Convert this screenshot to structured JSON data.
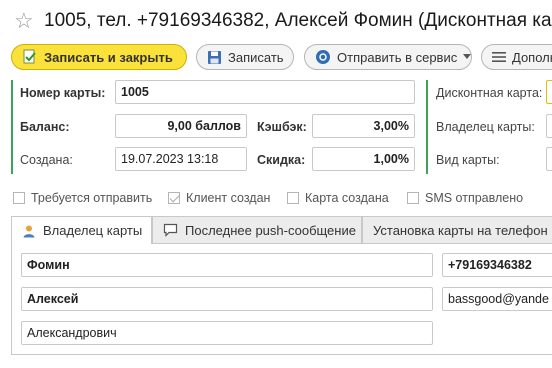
{
  "window": {
    "title": "1005, тел. +79169346382, Алексей Фомин (Дисконтная кар",
    "favorite_icon": "star-icon"
  },
  "toolbar": {
    "save_close_label": "Записать и закрыть",
    "save_label": "Записать",
    "send_label": "Отправить в сервис",
    "more_label": "Дополн"
  },
  "card": {
    "number_label": "Номер карты:",
    "number_value": "1005",
    "balance_label": "Баланс:",
    "balance_value": "9,00 баллов",
    "cashback_label": "Кэшбэк:",
    "cashback_value": "3,00%",
    "created_label": "Создана:",
    "created_value": "19.07.2023 13:18",
    "discount_label": "Скидка:",
    "discount_value": "1,00%"
  },
  "right_panel": {
    "discount_card_label": "Дисконтная карта:",
    "owner_label": "Владелец карты:",
    "card_type_label": "Вид карты:"
  },
  "flags": [
    {
      "label": "Требуется отправить",
      "checked": false
    },
    {
      "label": "Клиент создан",
      "checked": true
    },
    {
      "label": "Карта создана",
      "checked": false
    },
    {
      "label": "SMS отправлено",
      "checked": false
    }
  ],
  "tabs": [
    {
      "label": "Владелец карты",
      "icon": "person-icon",
      "active": true
    },
    {
      "label": "Последнее push-сообщение",
      "icon": "message-icon",
      "active": false
    },
    {
      "label": "Установка карты на телефон",
      "active": false
    }
  ],
  "owner": {
    "last_name": "Фомин",
    "first_name": "Алексей",
    "middle_name": "Александрович",
    "phone": "+79169346382",
    "email": "bassgood@yande"
  },
  "colors": {
    "primary_button": "#fbe23b",
    "accent_bar": "#3aa55a"
  }
}
